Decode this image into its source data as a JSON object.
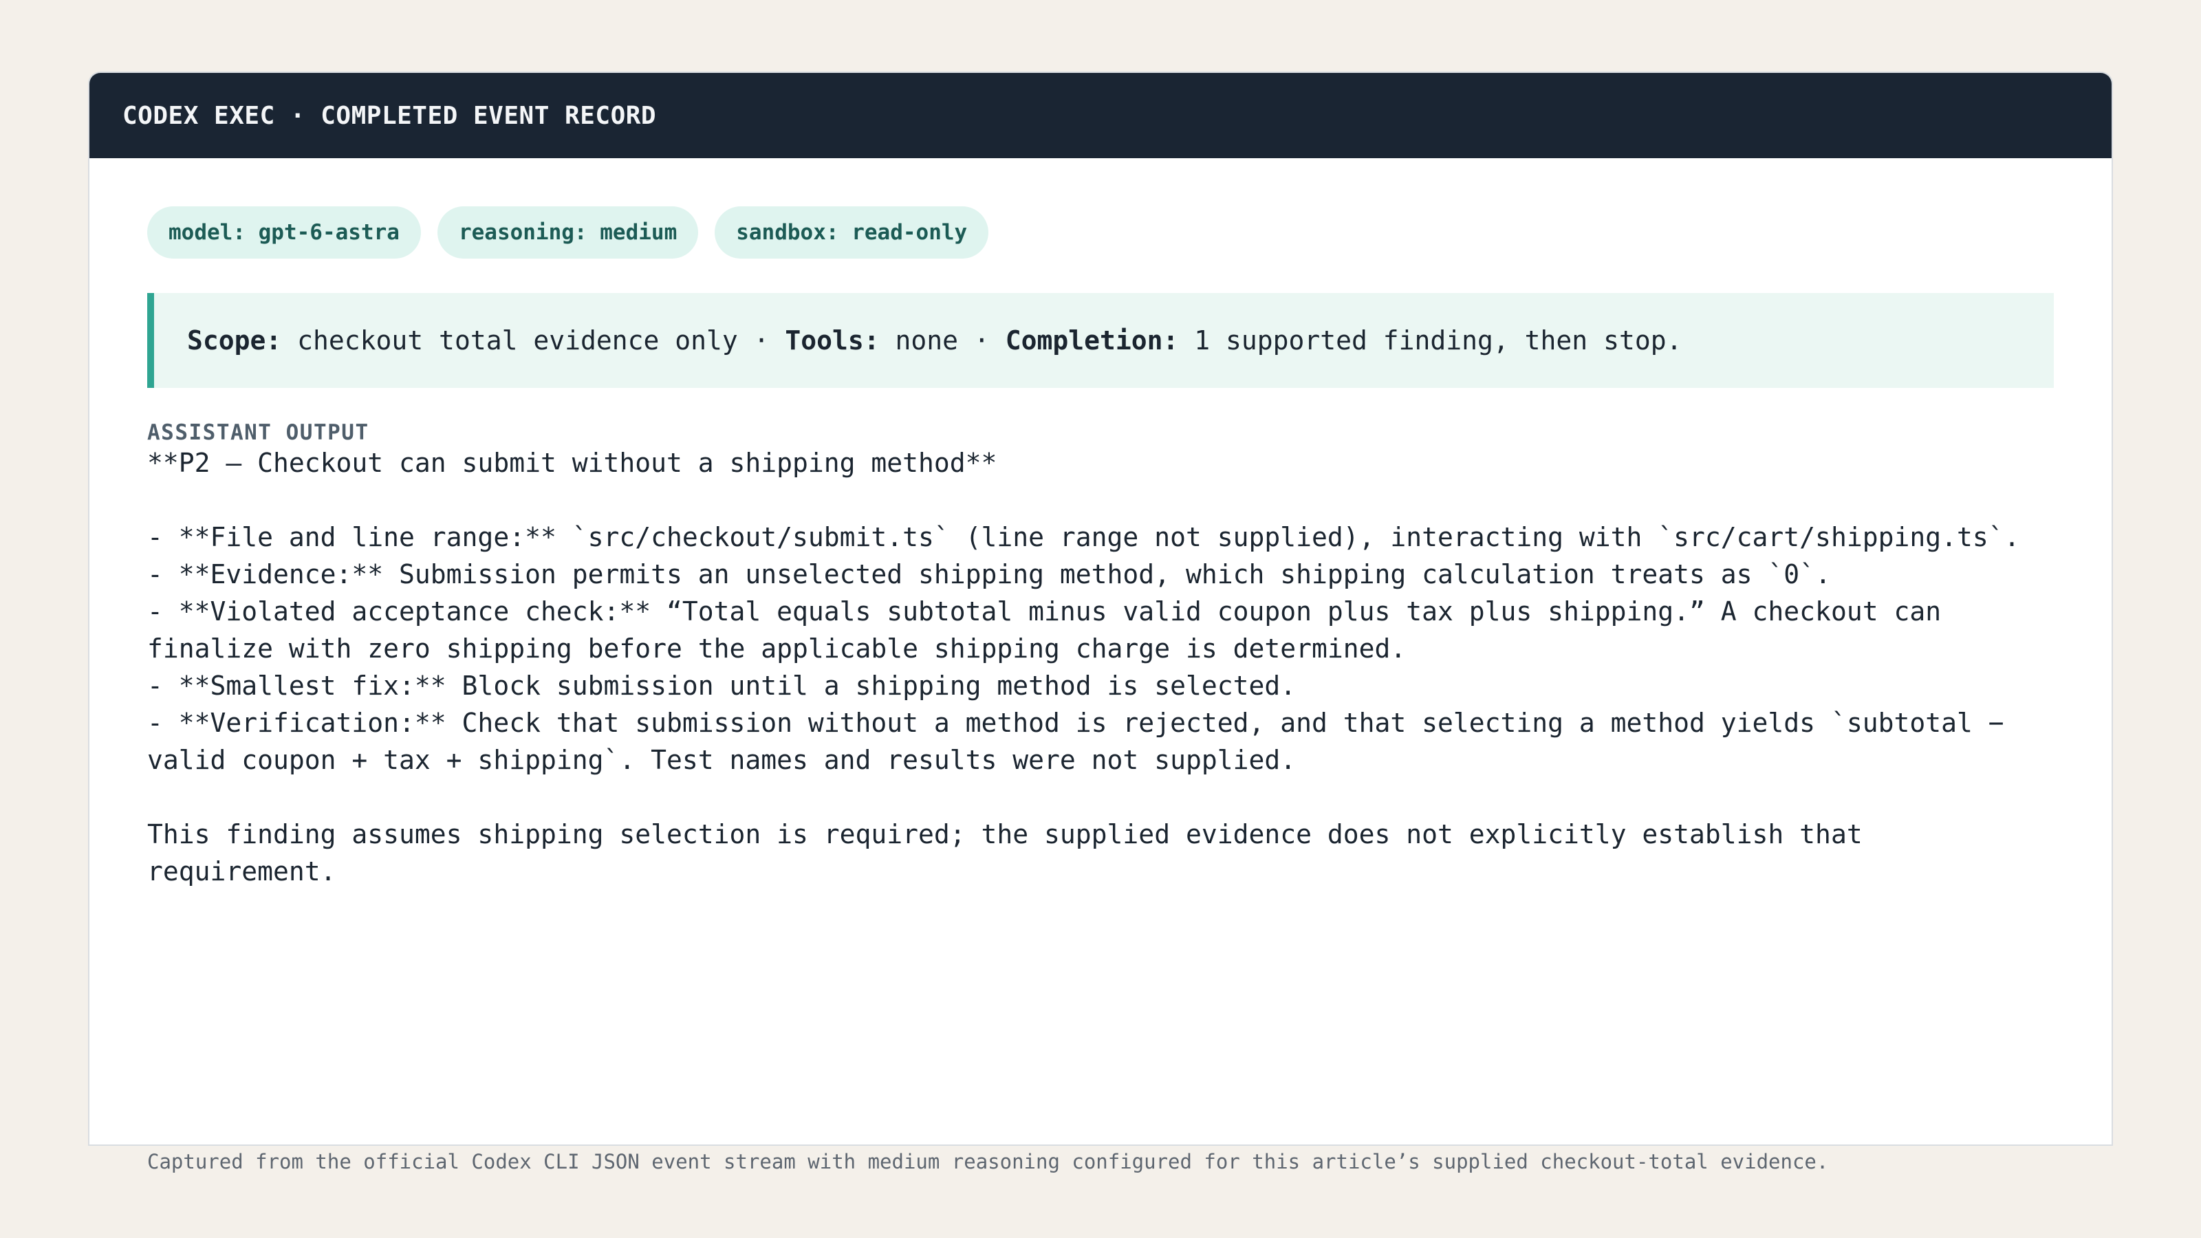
{
  "header": {
    "title": "CODEX EXEC · COMPLETED EVENT RECORD"
  },
  "badges": [
    "model: gpt-6-astra",
    "reasoning: medium",
    "sandbox: read-only"
  ],
  "scope": {
    "scope_label": "Scope:",
    "scope_value": " checkout total evidence only · ",
    "tools_label": "Tools:",
    "tools_value": " none · ",
    "completion_label": "Completion:",
    "completion_value": " 1 supported finding, then stop."
  },
  "output": {
    "label": "ASSISTANT OUTPUT",
    "heading": "**P2 — Checkout can submit without a shipping method**",
    "bullets": [
      "- **File and line range:** `src/checkout/submit.ts` (line range not supplied), interacting with `src/cart/shipping.ts`.",
      "- **Evidence:** Submission permits an unselected shipping method, which shipping calculation treats as `0`.",
      "- **Violated acceptance check:** “Total equals subtotal minus valid coupon plus tax plus shipping.” A checkout can finalize with zero shipping before the applicable shipping charge is determined.",
      "- **Smallest fix:** Block submission until a shipping method is selected.",
      "- **Verification:** Check that submission without a method is rejected, and that selecting a method yields `subtotal − valid coupon + tax + shipping`. Test names and results were not supplied."
    ],
    "closing": "This finding assumes shipping selection is required; the supplied evidence does not explicitly establish that requirement."
  },
  "footer": {
    "caption": "Captured from the official Codex CLI JSON event stream with medium reasoning configured for this article’s supplied checkout-total evidence."
  },
  "colors": {
    "page_bg": "#f4f0ea",
    "titlebar_bg": "#1a2533",
    "badge_bg": "#dff4ef",
    "badge_text": "#1c5b55",
    "scope_bg": "#ebf7f3",
    "scope_accent": "#2fa592"
  }
}
